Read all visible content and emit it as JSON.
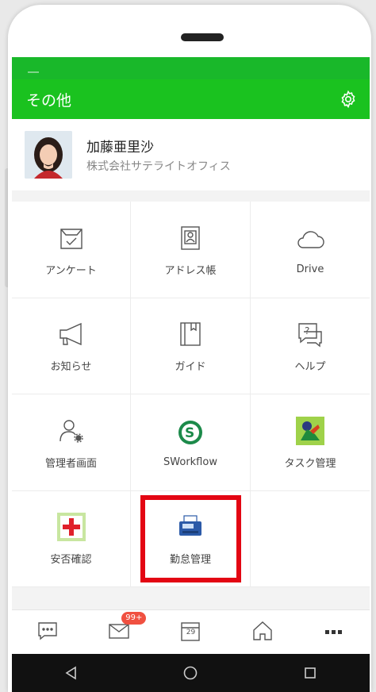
{
  "header": {
    "title": "その他"
  },
  "profile": {
    "name": "加藤亜里沙",
    "company": "株式会社サテライトオフィス"
  },
  "apps": [
    {
      "label": "アンケート",
      "icon": "survey-icon"
    },
    {
      "label": "アドレス帳",
      "icon": "address-book-icon"
    },
    {
      "label": "Drive",
      "icon": "cloud-icon"
    },
    {
      "label": "お知らせ",
      "icon": "megaphone-icon"
    },
    {
      "label": "ガイド",
      "icon": "guide-book-icon"
    },
    {
      "label": "ヘルプ",
      "icon": "help-icon"
    },
    {
      "label": "管理者画面",
      "icon": "admin-user-icon"
    },
    {
      "label": "SWorkflow",
      "icon": "sworkflow-logo-icon"
    },
    {
      "label": "タスク管理",
      "icon": "task-app-icon"
    },
    {
      "label": "安否確認",
      "icon": "safety-check-icon"
    },
    {
      "label": "勤怠管理",
      "icon": "time-clock-icon"
    }
  ],
  "tabbar": {
    "mail_badge": "99+",
    "calendar_day": "29"
  },
  "colors": {
    "header_green": "#1ac21f",
    "highlight_red": "#e30613",
    "badge_red": "#f05040"
  }
}
